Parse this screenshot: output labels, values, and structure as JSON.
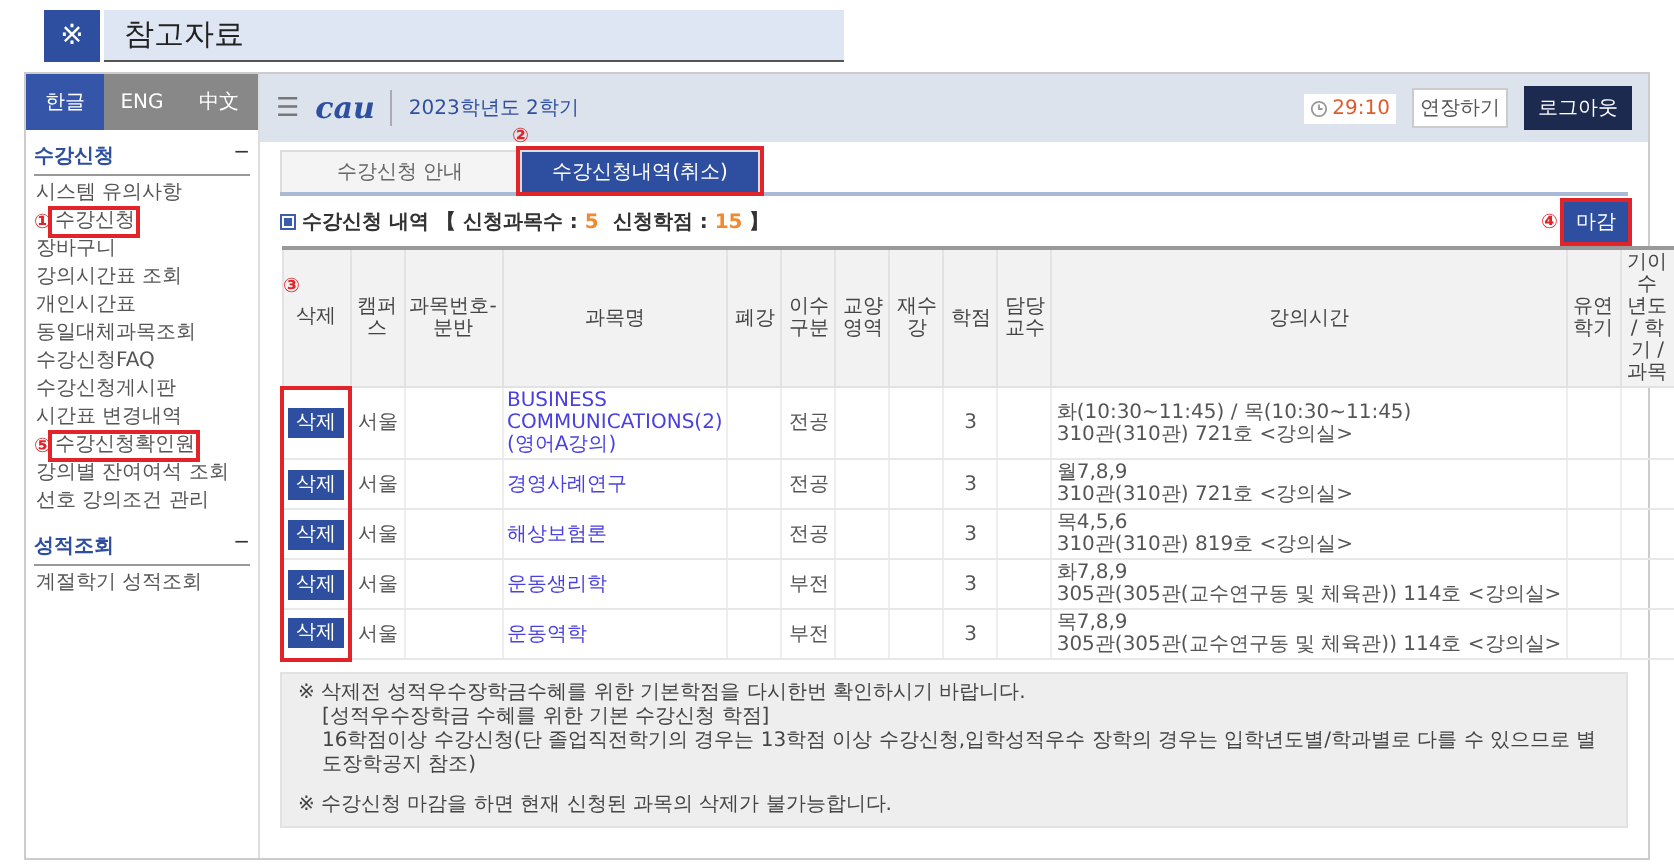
{
  "doc_header": {
    "symbol": "※",
    "title": "참고자료"
  },
  "languages": [
    {
      "label": "한글",
      "selected": true
    },
    {
      "label": "ENG",
      "selected": false
    },
    {
      "label": "中文",
      "selected": false
    }
  ],
  "sidebar": {
    "sections": [
      {
        "title": "수강신청",
        "toggle": "−",
        "items": [
          {
            "label": "시스템 유의사항"
          },
          {
            "label": "수강신청",
            "marker": "①"
          },
          {
            "label": "장바구니"
          },
          {
            "label": "강의시간표 조회"
          },
          {
            "label": "개인시간표"
          },
          {
            "label": "동일대체과목조회"
          },
          {
            "label": "수강신청FAQ"
          },
          {
            "label": "수강신청게시판"
          },
          {
            "label": "시간표 변경내역"
          },
          {
            "label": "수강신청확인원",
            "marker": "⑤"
          },
          {
            "label": "강의별 잔여여석 조회"
          },
          {
            "label": "선호 강의조건 관리"
          }
        ]
      },
      {
        "title": "성적조회",
        "toggle": "−",
        "items": [
          {
            "label": "계절학기 성적조회"
          }
        ]
      }
    ]
  },
  "header": {
    "menu": "☰",
    "logo": "cau",
    "term": "2023학년도 2학기",
    "timer": "29:10",
    "extend": "연장하기",
    "logout": "로그아웃"
  },
  "tabs": [
    {
      "label": "수강신청 안내",
      "selected": false
    },
    {
      "label": "수강신청내역(취소)",
      "selected": true,
      "marker": "②"
    }
  ],
  "summary": {
    "title": "수강신청 내역",
    "open": "【",
    "courses_label": "신청과목수 :",
    "courses": "5",
    "credits_label": "신청학점 :",
    "credits": "15",
    "close": "】"
  },
  "close_button": {
    "label": "마감",
    "marker": "④"
  },
  "table": {
    "delete_marker": "③",
    "columns": [
      "삭제",
      "캠퍼스",
      "과목번호-분반",
      "과목명",
      "폐강",
      "이수구분",
      "교양영역",
      "재수강",
      "학점",
      "담당교수",
      "강의시간",
      "유연학기",
      [
        "기이수",
        "년도 / 학기 / 과목"
      ]
    ],
    "rows": [
      {
        "delete": "삭제",
        "campus": "서울",
        "course": "BUSINESS COMMUNICATIONS(2)(영어A강의)",
        "type": "전공",
        "credit": "3",
        "time": [
          "화(10:30~11:45) / 목(10:30~11:45)",
          "310관(310관) 721호 <강의실>"
        ]
      },
      {
        "delete": "삭제",
        "campus": "서울",
        "course": "경영사례연구",
        "type": "전공",
        "credit": "3",
        "time": [
          "월7,8,9",
          "310관(310관) 721호 <강의실>"
        ]
      },
      {
        "delete": "삭제",
        "campus": "서울",
        "course": "해상보험론",
        "type": "전공",
        "credit": "3",
        "time": [
          "목4,5,6",
          "310관(310관) 819호 <강의실>"
        ]
      },
      {
        "delete": "삭제",
        "campus": "서울",
        "course": "운동생리학",
        "type": "부전",
        "credit": "3",
        "time": [
          "화7,8,9",
          "305관(305관(교수연구동 및 체육관)) 114호 <강의실>"
        ]
      },
      {
        "delete": "삭제",
        "campus": "서울",
        "course": "운동역학",
        "type": "부전",
        "credit": "3",
        "time": [
          "목7,8,9",
          "305관(305관(교수연구동 및 체육관)) 114호 <강의실>"
        ]
      }
    ]
  },
  "notes": [
    {
      "text": "※ 삭제전 성적우수장학금수혜를 위한 기본학점을 다시한번 확인하시기 바랍니다.",
      "indent": false
    },
    {
      "text": "[성적우수장학금 수혜를 위한 기본 수강신청 학점]",
      "indent": true
    },
    {
      "text": "16학점이상 수강신청(단 졸업직전학기의 경우는 13학점 이상 수강신청,입학성적우수 장학의 경우는 입학년도별/학과별로 다를 수 있으므로 별도장학공지 참조)",
      "indent": true
    },
    {
      "text": "※ 수강신청 마감을 하면 현재 신청된 과목의 삭제가 불가능합니다.",
      "indent": false
    }
  ]
}
